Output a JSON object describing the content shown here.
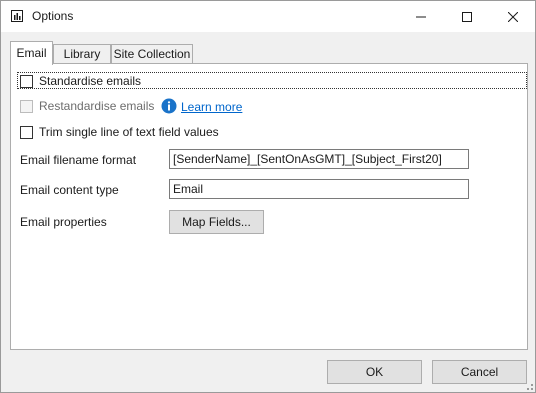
{
  "window": {
    "title": "Options"
  },
  "tabs": [
    {
      "label": "Email",
      "active": true
    },
    {
      "label": "Library",
      "active": false
    },
    {
      "label": "Site Collection",
      "active": false
    }
  ],
  "email_tab": {
    "standardise_emails": {
      "label": "Standardise emails",
      "checked": false
    },
    "restandardise_emails": {
      "label": "Restandardise emails",
      "checked": false,
      "enabled": false
    },
    "learn_more": "Learn more",
    "trim_values": {
      "label": "Trim single line of text field values",
      "checked": false
    },
    "filename_format": {
      "label": "Email filename format",
      "value": "[SenderName]_[SentOnAsGMT]_[Subject_First20]"
    },
    "content_type": {
      "label": "Email content type",
      "value": "Email"
    },
    "properties": {
      "label": "Email properties",
      "button": "Map Fields..."
    }
  },
  "footer": {
    "ok": "OK",
    "cancel": "Cancel"
  },
  "colors": {
    "link": "#0066cc",
    "info_icon": "#1a73c9",
    "button_face": "#e1e1e1"
  }
}
